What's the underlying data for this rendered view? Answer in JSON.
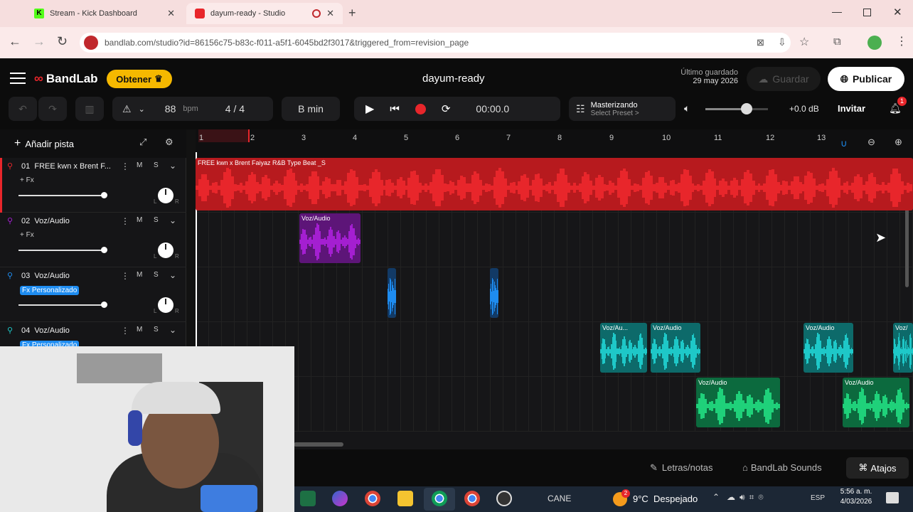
{
  "browser": {
    "tabs": [
      {
        "label": "Stream - Kick Dashboard"
      },
      {
        "label": "dayum-ready - Studio"
      }
    ],
    "url": "bandlab.com/studio?id=86156c75-b83c-f011-a5f1-6045bd2f3017&triggered_from=revision_page"
  },
  "app": {
    "logo": "BandLab",
    "obtener": "Obtener",
    "project": "dayum-ready",
    "saved_label": "Último guardado",
    "saved_date": "29 may 2026",
    "save": "Guardar",
    "publish": "Publicar",
    "bpm": "88",
    "bpm_unit": "bpm",
    "time_sig": "4 / 4",
    "key": "B min",
    "time": "00:00.0",
    "master_title": "Masterizando",
    "master_preset": "Select Preset >",
    "volume_db": "+0.0 dB",
    "invite": "Invitar",
    "notif_count": "1",
    "add_track": "Añadir pista"
  },
  "ruler": [
    "1",
    "2",
    "3",
    "4",
    "5",
    "6",
    "7",
    "8",
    "9",
    "10",
    "11",
    "12",
    "13"
  ],
  "tracks": [
    {
      "num": "01",
      "name": "FREE kwn x Brent F...",
      "fx": "+ Fx",
      "color": "#e8262b"
    },
    {
      "num": "02",
      "name": "Voz/Audio",
      "fx": "+ Fx",
      "color": "#a41fd1"
    },
    {
      "num": "03",
      "name": "Voz/Audio",
      "fx": "Fx Personalizado",
      "color": "#1e8cf0"
    },
    {
      "num": "04",
      "name": "Voz/Audio",
      "fx": "Fx Personalizado",
      "color": "#1ec8c8"
    }
  ],
  "clips": {
    "beat": "FREE kwn x Brent Faiyaz R&B Type Beat _S",
    "voz": "Voz/Audio",
    "voz_short": "Voz/Au...",
    "voz_cut": "Voz/"
  },
  "bottom": {
    "lyrics": "Letras/notas",
    "sounds": "BandLab Sounds",
    "shortcuts": "Atajos"
  },
  "taskbar": {
    "cane": "CANE",
    "weather": "9°C  Despejado",
    "lang": "ESP",
    "clock": "5:56 a. m.",
    "date": "4/03/2026",
    "notif": "2"
  },
  "colors": {
    "red": "#e8262b",
    "purple": "#a41fd1",
    "blue": "#1e8cf0",
    "cyan": "#1ec8c8",
    "green": "#1fd17a",
    "accent": "#f5b800"
  }
}
